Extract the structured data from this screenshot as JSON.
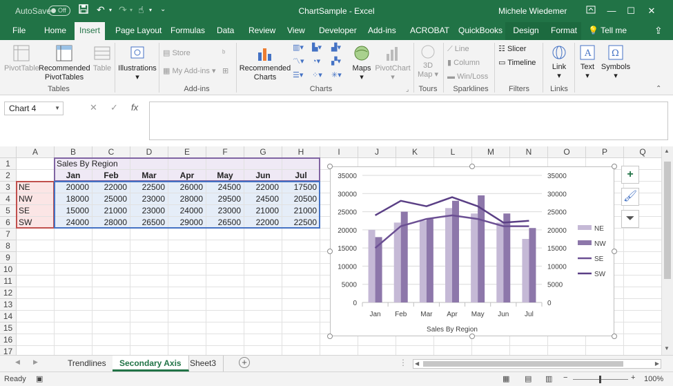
{
  "titlebar": {
    "autosave_label": "AutoSave",
    "autosave_state": "Off",
    "title": "ChartSample - Excel",
    "user": "Michele Wiedemer"
  },
  "tabs": [
    "File",
    "Home",
    "Insert",
    "Page Layout",
    "Formulas",
    "Data",
    "Review",
    "View",
    "Developer",
    "Add-ins",
    "ACROBAT",
    "QuickBooks",
    "Design",
    "Format"
  ],
  "tell_me": "Tell me",
  "ribbon": {
    "pivottable": "PivotTable",
    "recommended_pivot_1": "Recommended",
    "recommended_pivot_2": "PivotTables",
    "table": "Table",
    "tables_group": "Tables",
    "illustrations": "Illustrations",
    "store": "Store",
    "my_addins": "My Add-ins",
    "addins_group": "Add-ins",
    "recommended_charts_1": "Recommended",
    "recommended_charts_2": "Charts",
    "maps": "Maps",
    "pivotchart": "PivotChart",
    "charts_group": "Charts",
    "map3d_1": "3D",
    "map3d_2": "Map",
    "tours_group": "Tours",
    "line": "Line",
    "column": "Column",
    "winloss": "Win/Loss",
    "sparklines_group": "Sparklines",
    "slicer": "Slicer",
    "timeline": "Timeline",
    "filters_group": "Filters",
    "link": "Link",
    "links_group": "Links",
    "text": "Text",
    "symbols": "Symbols"
  },
  "namebox": "Chart 4",
  "columns": [
    "A",
    "B",
    "C",
    "D",
    "E",
    "F",
    "G",
    "H",
    "I",
    "J",
    "K",
    "L",
    "M",
    "N",
    "O",
    "P",
    "Q"
  ],
  "rows": [
    "1",
    "2",
    "3",
    "4",
    "5",
    "6",
    "7",
    "8",
    "9",
    "10",
    "11",
    "12",
    "13",
    "14",
    "15",
    "16",
    "17"
  ],
  "sheet": {
    "title": "Sales By Region",
    "months": [
      "Jan",
      "Feb",
      "Mar",
      "Apr",
      "May",
      "Jun",
      "Jul"
    ],
    "regions": [
      {
        "name": "NE",
        "values": [
          "20000",
          "22000",
          "22500",
          "26000",
          "24500",
          "22000",
          "17500"
        ]
      },
      {
        "name": "NW",
        "values": [
          "18000",
          "25000",
          "23000",
          "28000",
          "29500",
          "24500",
          "20500"
        ]
      },
      {
        "name": "SE",
        "values": [
          "15000",
          "21000",
          "23000",
          "24000",
          "23000",
          "21000",
          "21000"
        ]
      },
      {
        "name": "SW",
        "values": [
          "24000",
          "28000",
          "26500",
          "29000",
          "26500",
          "22000",
          "22500"
        ]
      }
    ]
  },
  "chart_data": {
    "type": "bar",
    "categories": [
      "Jan",
      "Feb",
      "Mar",
      "Apr",
      "May",
      "Jun",
      "Jul"
    ],
    "series": [
      {
        "name": "NE",
        "kind": "bar",
        "values": [
          20000,
          22000,
          22500,
          26000,
          24500,
          22000,
          17500
        ],
        "color": "#c5b9d6"
      },
      {
        "name": "NW",
        "kind": "bar",
        "values": [
          18000,
          25000,
          23000,
          28000,
          29500,
          24500,
          20500
        ],
        "color": "#8d77aa"
      },
      {
        "name": "SE",
        "kind": "line",
        "axis": "secondary",
        "values": [
          15000,
          21000,
          23000,
          24000,
          23000,
          21000,
          21000
        ],
        "color": "#6b4f93"
      },
      {
        "name": "SW",
        "kind": "line",
        "axis": "secondary",
        "values": [
          24000,
          28000,
          26500,
          29000,
          26500,
          22000,
          22500
        ],
        "color": "#5a3f85"
      }
    ],
    "yticks": [
      "0",
      "5000",
      "10000",
      "15000",
      "20000",
      "25000",
      "30000",
      "35000"
    ],
    "ylim": [
      0,
      35000
    ],
    "y2lim": [
      0,
      35000
    ],
    "xlabel": "Sales By Region",
    "legend_position": "right",
    "grid": true
  },
  "sheet_tabs": [
    "Trendlines",
    "Secondary Axis",
    "Sheet3"
  ],
  "active_sheet": "Secondary Axis",
  "status": {
    "ready": "Ready",
    "zoom": "100%"
  }
}
